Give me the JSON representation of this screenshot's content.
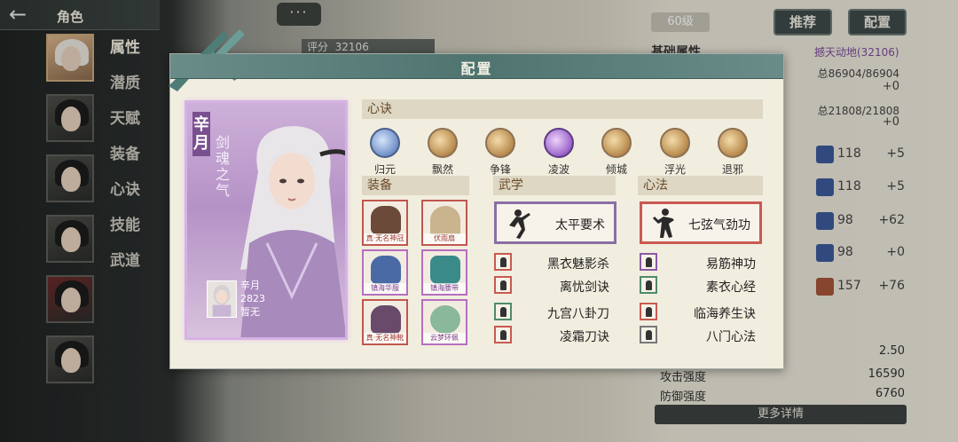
{
  "topbar": {
    "title": "角色"
  },
  "side_tabs": [
    "属性",
    "潜质",
    "天赋",
    "装备",
    "心诀",
    "技能",
    "武道"
  ],
  "header": {
    "bubble": "···",
    "score_label": "评分",
    "score_value": "32106",
    "level": "60级",
    "recommend_btn": "推荐",
    "config_btn": "配置"
  },
  "right_panel": {
    "title": "基础属性",
    "sub": "撼天动地(32106)",
    "hp": "总86904/86904",
    "hp_plus": "+0",
    "mp": "总21808/21808",
    "mp_plus": "+0",
    "stats": [
      {
        "value": "118",
        "plus": "+5"
      },
      {
        "value": "118",
        "plus": "+5"
      },
      {
        "value": "98",
        "plus": "+62"
      },
      {
        "value": "98",
        "plus": "+0"
      },
      {
        "value": "157",
        "plus": "+76"
      }
    ],
    "bottom": [
      {
        "label": "",
        "value": "2.50"
      },
      {
        "label": "攻击强度",
        "value": "16590"
      },
      {
        "label": "防御强度",
        "value": "6760"
      }
    ],
    "more": "更多详情"
  },
  "modal": {
    "title": "配置",
    "character": {
      "name": "辛月",
      "title": "剑魂之气",
      "mini_name": "辛月",
      "mini_level": "2823",
      "mini_status": "暂无"
    },
    "xinjue": {
      "header": "心诀",
      "skills": [
        {
          "label": "归元",
          "icon": "guiyuan-icon",
          "tone": "blue"
        },
        {
          "label": "飘然",
          "icon": "piaoran-icon",
          "tone": "gold"
        },
        {
          "label": "争锋",
          "icon": "zhengfeng-icon",
          "tone": "gold"
        },
        {
          "label": "凌波",
          "icon": "lingbo-icon",
          "tone": "purple"
        },
        {
          "label": "倾城",
          "icon": "qingcheng-icon",
          "tone": "gold"
        },
        {
          "label": "浮光",
          "icon": "fuguang-icon",
          "tone": "gold"
        },
        {
          "label": "退邪",
          "icon": "tuixie-icon",
          "tone": "gold"
        }
      ]
    },
    "equipment": {
      "header": "装备",
      "items": [
        {
          "tag": "真·无名神冠"
        },
        {
          "tag": "伏雨扇"
        },
        {
          "tag": "镇海华服"
        },
        {
          "tag": "镇海腰带"
        },
        {
          "tag": "真·无名神靴"
        },
        {
          "tag": "云梦环佩"
        }
      ]
    },
    "wuxue": {
      "header": "武学",
      "main": "太平要术",
      "list": [
        "黑衣魅影杀",
        "离忧剑诀",
        "九宫八卦刀",
        "凌霜刀诀"
      ]
    },
    "xinfa": {
      "header": "心法",
      "main": "七弦气劲功",
      "list": [
        "易筋神功",
        "素衣心经",
        "临海养生诀",
        "八门心法"
      ]
    }
  }
}
